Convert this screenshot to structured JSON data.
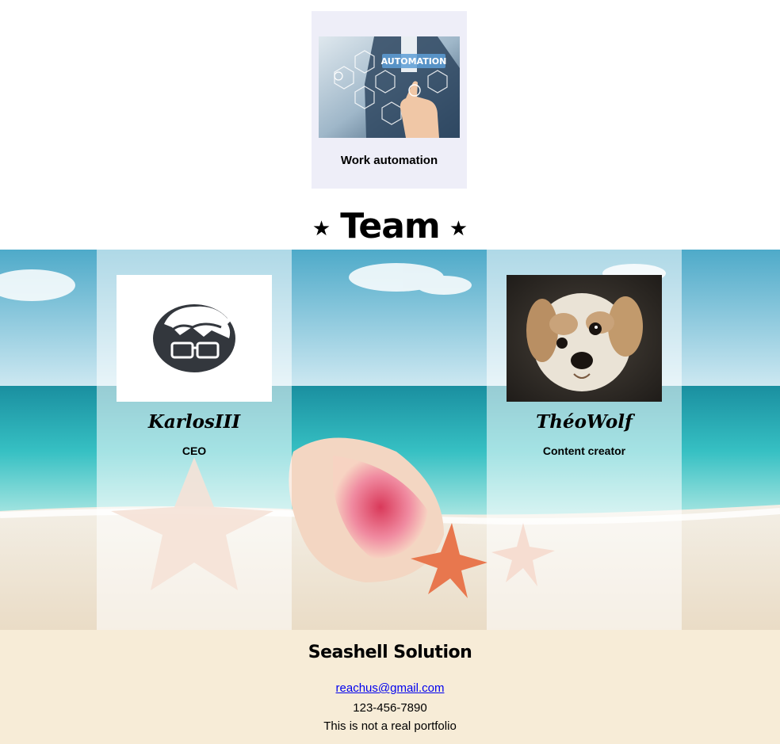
{
  "service": {
    "image_text": "AUTOMATION",
    "caption": "Work automation"
  },
  "team": {
    "heading": "Team",
    "star_glyph": "★",
    "members": [
      {
        "name": "KarlosIII",
        "role": "CEO",
        "avatar": "glasses-avatar-icon"
      },
      {
        "name": "ThéoWolf",
        "role": "Content creator",
        "avatar": "dog-photo"
      }
    ]
  },
  "footer": {
    "title": "Seashell Solution",
    "email": "reachus@gmail.com",
    "phone": "123-456-7890",
    "note": "This is not a real portfolio"
  },
  "colors": {
    "service_card_bg": "#eeeef8",
    "footer_bg": "#f7ecd7",
    "link": "#0000ee",
    "avatar_dark": "#33373d"
  }
}
